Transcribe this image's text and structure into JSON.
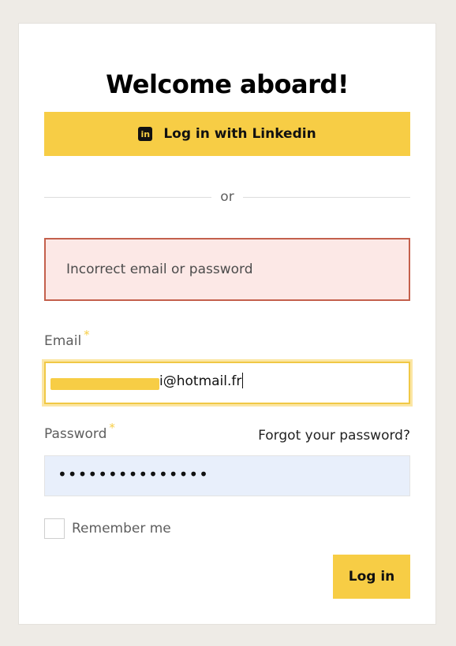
{
  "title": "Welcome aboard!",
  "linkedin": {
    "label": "Log in with Linkedin",
    "icon": "linkedin-icon",
    "icon_text": "in"
  },
  "divider": {
    "label": "or"
  },
  "error": {
    "message": "Incorrect email or password"
  },
  "email": {
    "label": "Email",
    "required_mark": "*",
    "value": "i@hotmail.fr"
  },
  "password": {
    "label": "Password",
    "required_mark": "*",
    "value_masked": "•••••••••••••••",
    "forgot_label": "Forgot your password?"
  },
  "remember": {
    "label": "Remember me",
    "checked": false
  },
  "submit": {
    "label": "Log in"
  },
  "colors": {
    "accent": "#f7cd45",
    "error_bg": "#fce8e6",
    "error_border": "#c4604c",
    "autofill_bg": "#e8effb",
    "page_bg": "#eeebe6"
  }
}
